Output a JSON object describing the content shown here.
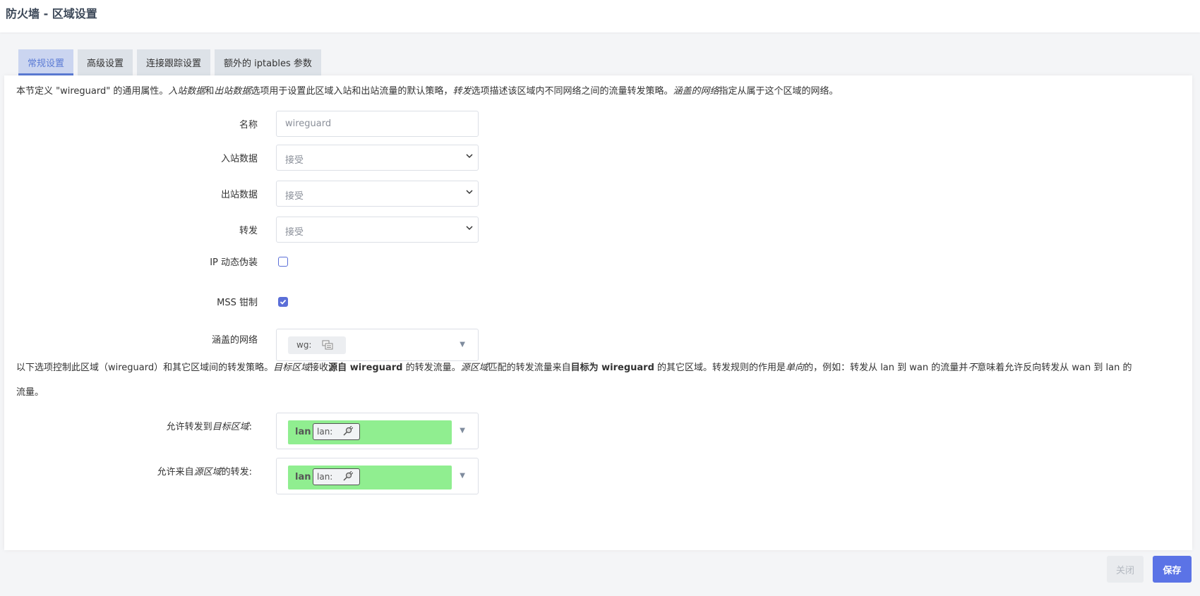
{
  "header": {
    "title": "防火墙 - 区域设置"
  },
  "tabs": [
    {
      "label": "常规设置",
      "active": true
    },
    {
      "label": "高级设置",
      "active": false
    },
    {
      "label": "连接跟踪设置",
      "active": false
    },
    {
      "label": "额外的 iptables 参数",
      "active": false
    }
  ],
  "intro": {
    "p1": "本节定义 \"wireguard\" 的通用属性。",
    "p2": "入站数据",
    "p3": "和",
    "p4": "出站数据",
    "p5": "选项用于设置此区域入站和出站流量的默认策略，",
    "p6": "转发",
    "p7": "选项描述该区域内不同网络之间的流量转发策略。",
    "p8": "涵盖的网络",
    "p9": "指定从属于这个区域的网络。"
  },
  "form": {
    "name": {
      "label": "名称",
      "value": "wireguard"
    },
    "input": {
      "label": "入站数据",
      "value": "接受"
    },
    "output": {
      "label": "出站数据",
      "value": "接受"
    },
    "forward": {
      "label": "转发",
      "value": "接受"
    },
    "masq": {
      "label": "IP 动态伪装",
      "checked": false
    },
    "mss": {
      "label": "MSS 钳制",
      "checked": true
    },
    "networks": {
      "label": "涵盖的网络",
      "chip": "wg:"
    }
  },
  "policy_text": {
    "line1": {
      "a": "以下选项控制此区域（wireguard）和其它区域间的转发策略。",
      "b": "目标区域",
      "c": "接收",
      "d": "源自 wireguard",
      "e": " 的转发流量。",
      "f": "源区域",
      "g": "匹配的转发流量来自",
      "h": "目标为 wireguard",
      "i": " 的其它区域。转发规则的作用是",
      "j": "单向",
      "k": "的，例如：转发从 lan 到 wan 的流量并",
      "l": "不",
      "m": "意味着允许反向转发从 wan 到 lan 的"
    },
    "line2": "流量。"
  },
  "forward_dest": {
    "label_a": "允许转发到",
    "label_b": "目标区域",
    "label_c": ":",
    "zone": "lan",
    "badge": "lan:"
  },
  "forward_src": {
    "label_a": "允许来自",
    "label_b": "源区域",
    "label_c": "的转发:",
    "zone": "lan",
    "badge": "lan:"
  },
  "footer": {
    "close": "关闭",
    "save": "保存"
  },
  "colors": {
    "accent": "#5b73e6",
    "zone_lan": "#90ee90"
  }
}
